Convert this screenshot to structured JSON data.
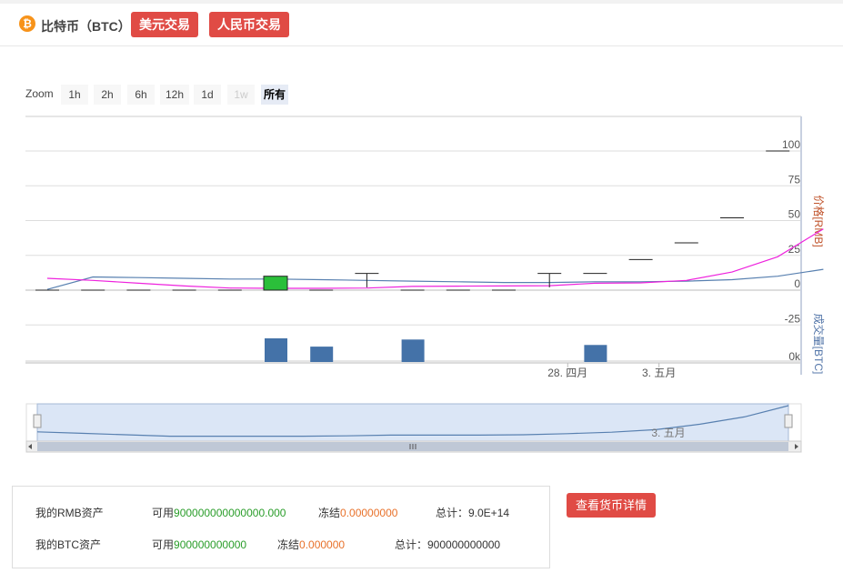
{
  "header": {
    "coin_icon": "bitcoin-icon",
    "coin_glyph": "₿",
    "title": "比特币（BTC）",
    "usd_trade": "美元交易",
    "rmb_trade": "人民币交易"
  },
  "zoom": {
    "label": "Zoom",
    "buttons": [
      "1h",
      "2h",
      "6h",
      "12h",
      "1d",
      "1w",
      "所有"
    ],
    "disabled": "1w",
    "selected": "所有"
  },
  "chart_data": {
    "type": "candlestick",
    "price_axis": {
      "title": "价格[RMB]",
      "ticks": [
        -25,
        0,
        25,
        50,
        75,
        100
      ],
      "range": [
        -25,
        100
      ]
    },
    "volume_axis": {
      "title": "成交量[BTC]",
      "ticks_label": "0k"
    },
    "x_tick_labels": [
      {
        "label": "28. 四月",
        "index": 11.4
      },
      {
        "label": "3. 五月",
        "index": 13.4
      }
    ],
    "candles": [
      {
        "open": 0,
        "high": 0,
        "low": 0,
        "close": 0
      },
      {
        "open": 0,
        "high": 0,
        "low": 0,
        "close": 0
      },
      {
        "open": 0,
        "high": 0,
        "low": 0,
        "close": 0
      },
      {
        "open": 0,
        "high": 0,
        "low": 0,
        "close": 0
      },
      {
        "open": 0,
        "high": 0,
        "low": 0,
        "close": 0
      },
      {
        "open": 0,
        "high": 10,
        "low": 0,
        "close": 10
      },
      {
        "open": 0,
        "high": 0,
        "low": 0,
        "close": 0
      },
      {
        "open": 12,
        "high": 12,
        "low": 2,
        "close": 12
      },
      {
        "open": 0,
        "high": 0,
        "low": 0,
        "close": 0
      },
      {
        "open": 0,
        "high": 0,
        "low": 0,
        "close": 0
      },
      {
        "open": 0,
        "high": 0,
        "low": 0,
        "close": 0
      },
      {
        "open": 12,
        "high": 12,
        "low": 2,
        "close": 12
      },
      {
        "open": 12,
        "high": 12,
        "low": 12,
        "close": 12
      },
      {
        "open": 22,
        "high": 22,
        "low": 22,
        "close": 22
      },
      {
        "open": 34,
        "high": 34,
        "low": 34,
        "close": 34
      },
      {
        "open": 52,
        "high": 52,
        "low": 52,
        "close": 52
      },
      {
        "open": 100,
        "high": 100,
        "low": 100,
        "close": 100
      }
    ],
    "volumes": [
      0,
      0,
      0,
      0,
      0,
      1,
      0.65,
      0,
      0.95,
      0,
      0,
      0,
      0.72,
      0,
      0,
      0,
      0,
      0
    ],
    "ma_pink": [
      8.5,
      7,
      5,
      3,
      1.5,
      1.3,
      1.3,
      1.5,
      2.7,
      2.9,
      3,
      3.2,
      5,
      5.2,
      7,
      13,
      24,
      44
    ],
    "ma_blue": [
      0.5,
      9.5,
      9,
      8.5,
      8,
      8,
      7.5,
      7,
      6.5,
      6,
      5.5,
      5.5,
      6,
      6,
      6.5,
      7.5,
      10,
      15
    ],
    "navigator": {
      "label": "3. 五月",
      "series": [
        0.46,
        0.38,
        0.3,
        0.22,
        0.22,
        0.22,
        0.22,
        0.24,
        0.28,
        0.28,
        0.28,
        0.3,
        0.36,
        0.44,
        0.58,
        0.88,
        1.28,
        1.9
      ]
    }
  },
  "assets": {
    "rmb_label": "我的RMB资产",
    "rmb_avail_label": "可用",
    "rmb_avail": "900000000000000.000",
    "rmb_frozen_label": "冻结",
    "rmb_frozen": "0.00000000",
    "rmb_total": "总计：9.0E+14",
    "btc_label": "我的BTC资产",
    "btc_avail_label": "可用",
    "btc_avail": "900000000000",
    "btc_frozen_label": "冻结",
    "btc_frozen": "0.000000",
    "btc_total": "总计：900000000000"
  },
  "detail_button": "查看货币详情",
  "colors": {
    "accent_red": "#e04b45",
    "up_candle": "#2bbf3a",
    "volume_bar": "#4472a8",
    "ma_pink": "#ee22dd",
    "ma_blue": "#5880b0",
    "available_green": "#2a9d2a",
    "frozen_orange": "#e8712a"
  }
}
